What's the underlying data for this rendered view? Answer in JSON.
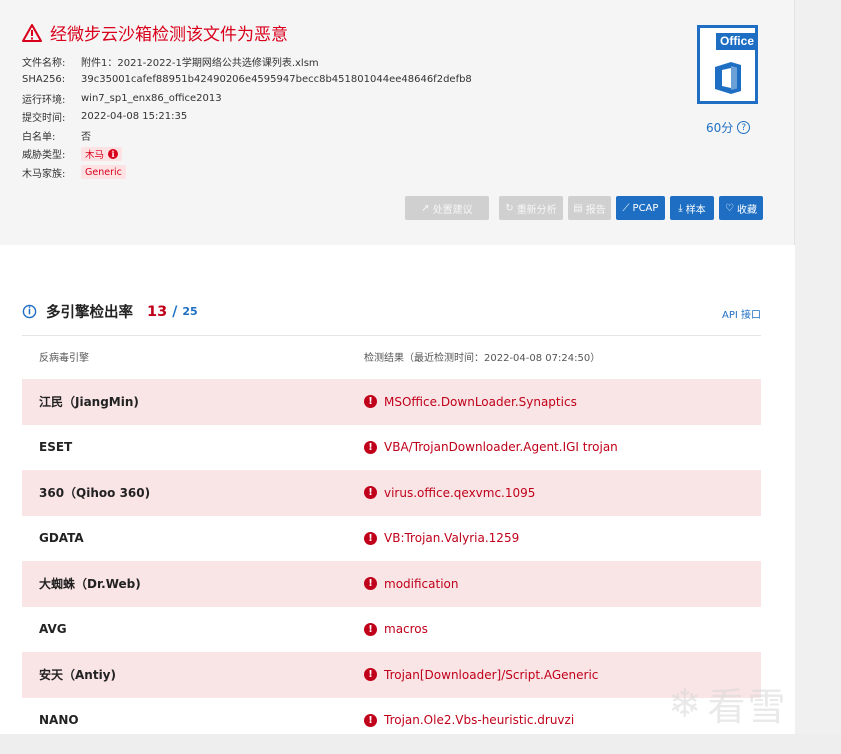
{
  "header": {
    "title": "经微步云沙箱检测该文件为恶意",
    "icon": "warning-triangle-icon"
  },
  "file_info": [
    {
      "label": "文件名称:",
      "value": "附件1：2021-2022-1学期网络公共选修课列表.xlsm"
    },
    {
      "label": "SHA256:",
      "value": "39c35001cafef88951b42490206e4595947becc8b451801044ee48646f2defb8"
    },
    {
      "label": "运行环境:",
      "value": "win7_sp1_enx86_office2013"
    },
    {
      "label": "提交时间:",
      "value": "2022-04-08 15:21:35"
    },
    {
      "label": "白名单:",
      "value": "否"
    }
  ],
  "threat_type": {
    "label": "威胁类型:",
    "value": "木马"
  },
  "trojan_family": {
    "label": "木马家族:",
    "value": "Generic"
  },
  "file_type_badge": {
    "label": "Office",
    "icon": "office-document-icon"
  },
  "score": {
    "value": "60分",
    "icon": "question-circle-icon"
  },
  "actions": [
    {
      "label": "处置建议",
      "icon": "rocket-icon",
      "enabled": false
    },
    {
      "label": "重新分析",
      "icon": "refresh-icon",
      "enabled": false
    },
    {
      "label": "报告",
      "icon": "report-icon",
      "enabled": false
    },
    {
      "label": "PCAP",
      "icon": "pcap-icon",
      "enabled": true
    },
    {
      "label": "样本",
      "icon": "download-icon",
      "enabled": true
    },
    {
      "label": "收藏",
      "icon": "heart-icon",
      "enabled": true
    }
  ],
  "detection": {
    "title": "多引擎检出率",
    "detected": "13",
    "separator": "/",
    "total": "25",
    "api_link": "API 接口",
    "col_engine": "反病毒引擎",
    "col_result": "检测结果（最近检测时间：2022-04-08 07:24:50）",
    "rows": [
      {
        "engine": "江民（JiangMin)",
        "result": "MSOffice.DownLoader.Synaptics"
      },
      {
        "engine": "ESET",
        "result": "VBA/TrojanDownloader.Agent.IGI trojan"
      },
      {
        "engine": "360（Qihoo 360)",
        "result": "virus.office.qexvmc.1095"
      },
      {
        "engine": "GDATA",
        "result": "VB:Trojan.Valyria.1259"
      },
      {
        "engine": "大蜘蛛（Dr.Web)",
        "result": "modification"
      },
      {
        "engine": "AVG",
        "result": "macros"
      },
      {
        "engine": "安天（Antiy)",
        "result": "Trojan[Downloader]/Script.AGeneric"
      },
      {
        "engine": "NANO",
        "result": "Trojan.Ole2.Vbs-heuristic.druvzi"
      }
    ]
  },
  "watermark": {
    "text": "看雪",
    "icon": "snowflake-icon"
  },
  "colors": {
    "danger": "#d9001b",
    "accent": "#1e6fc4",
    "row_alt": "#fae5e6"
  }
}
